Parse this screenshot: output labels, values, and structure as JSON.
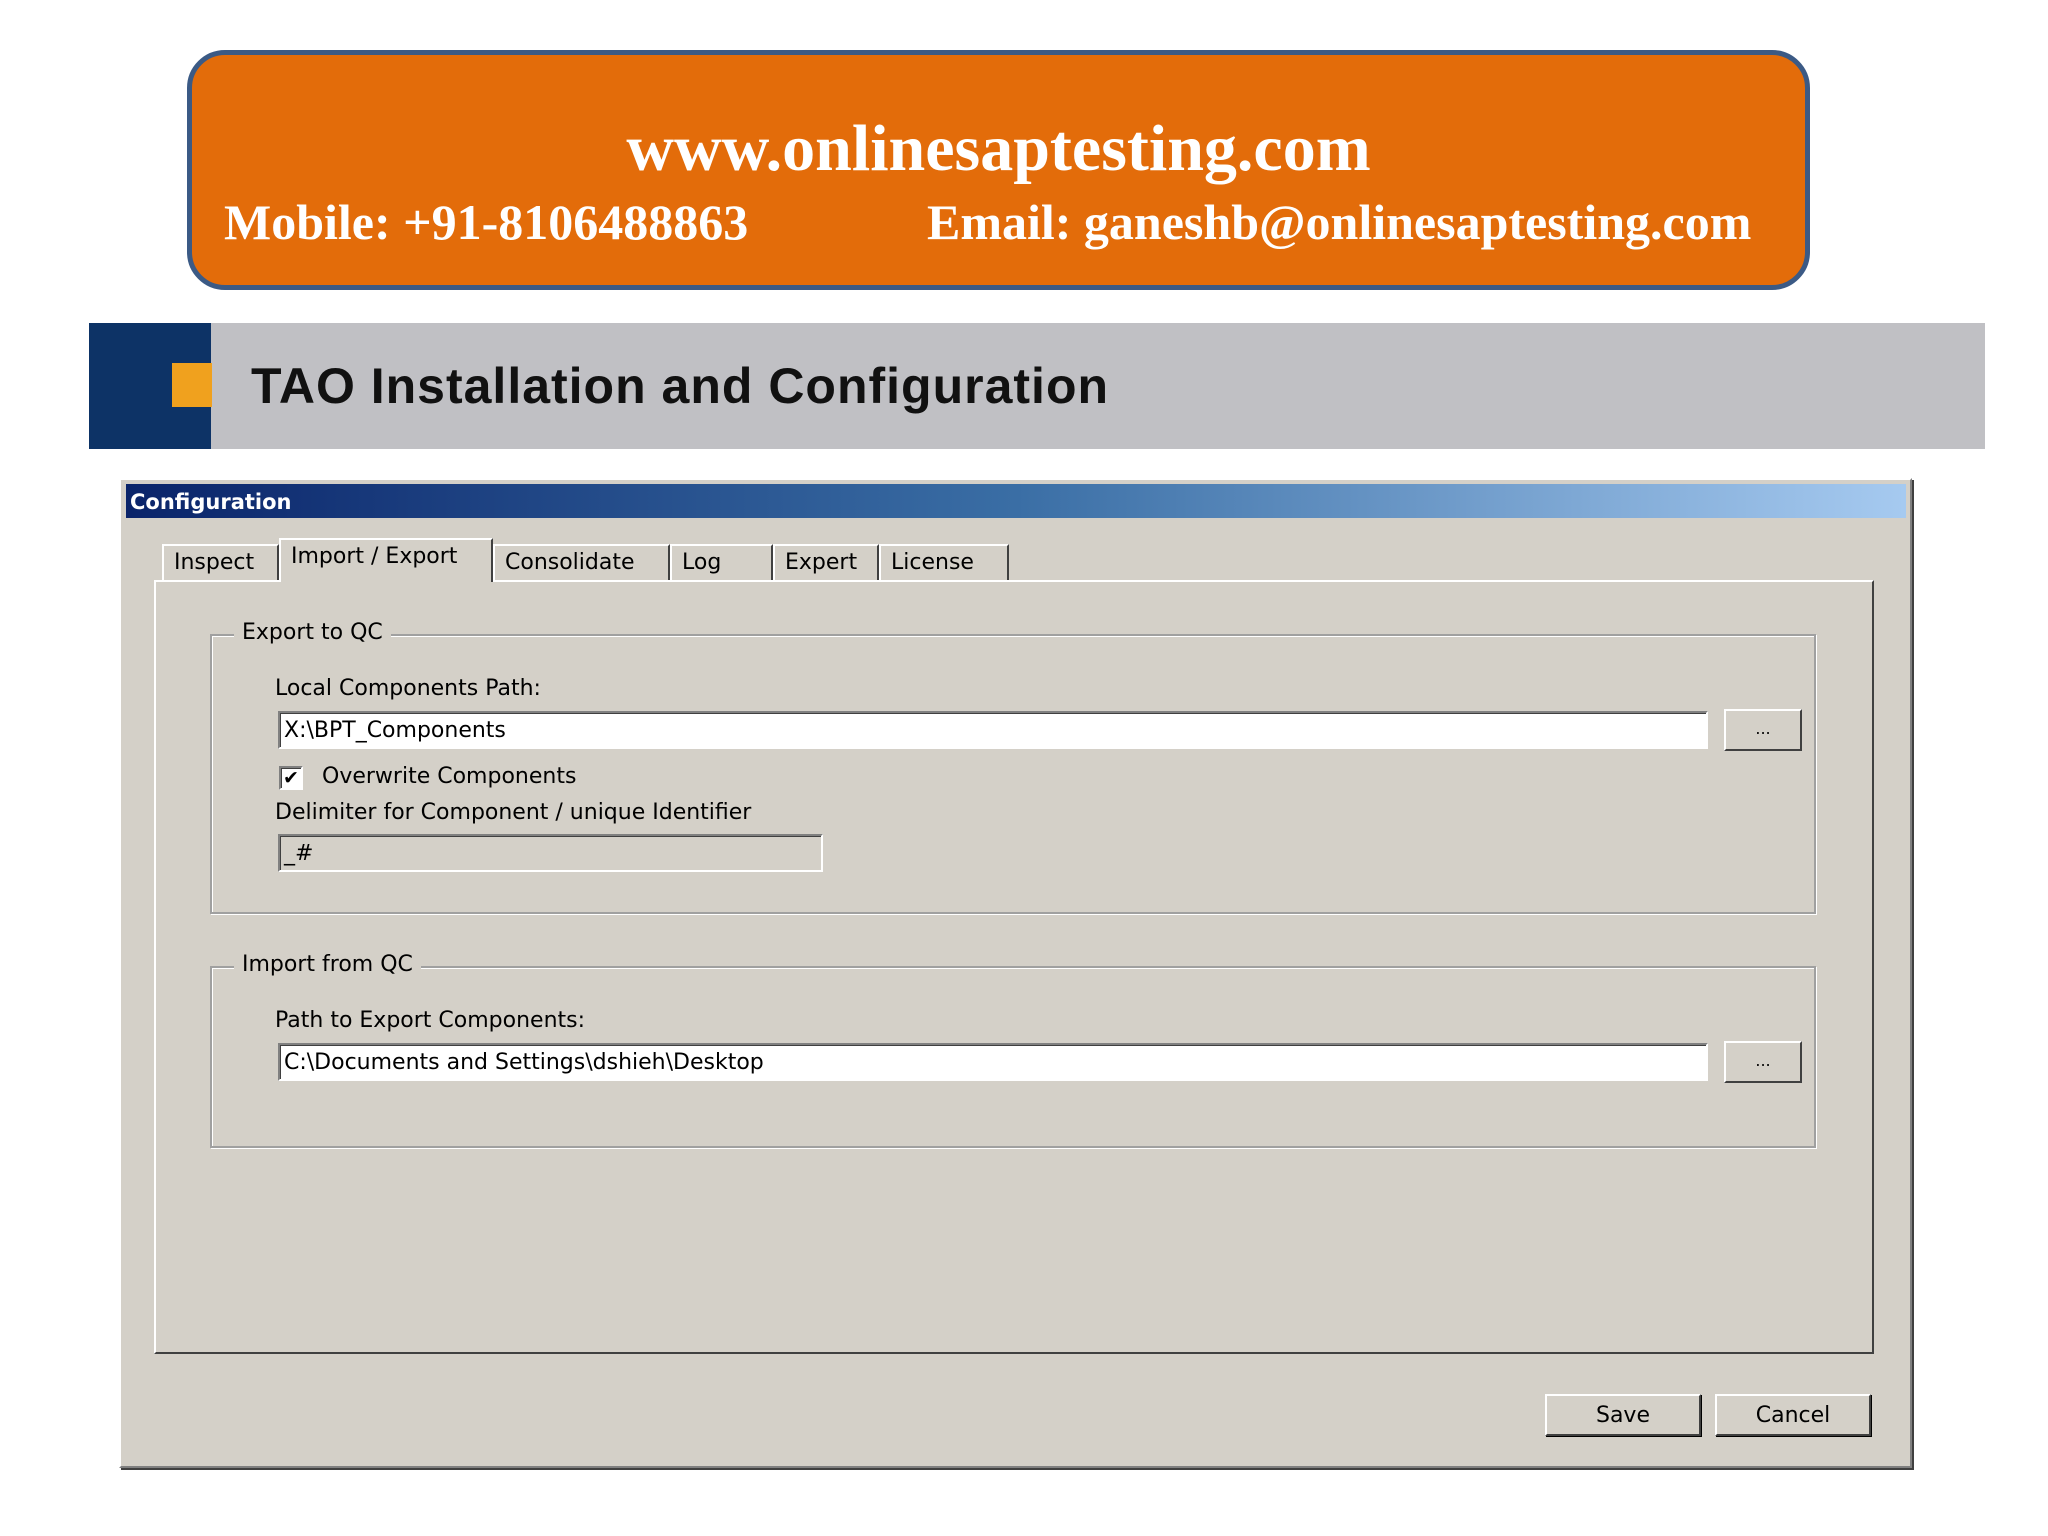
{
  "banner": {
    "url": "www.onlinesaptesting.com",
    "mobile": "Mobile: +91-8106488863",
    "email": "Email: ganeshb@onlinesaptesting.com"
  },
  "slide": {
    "title": "TAO Installation and Configuration"
  },
  "dialog": {
    "title": "Configuration",
    "tabs": [
      {
        "label": "Inspect"
      },
      {
        "label": "Import / Export",
        "active": true
      },
      {
        "label": "Consolidate"
      },
      {
        "label": "Log"
      },
      {
        "label": "Expert"
      },
      {
        "label": "License"
      }
    ],
    "export_group": {
      "title": "Export to QC",
      "path_label": "Local Components Path:",
      "path_value": "X:\\BPT_Components",
      "browse_label": "...",
      "overwrite_label": "Overwrite Components",
      "overwrite_checked": true,
      "check_glyph": "✔",
      "delimiter_label": "Delimiter for Component / unique Identifier",
      "delimiter_value": "_#"
    },
    "import_group": {
      "title": "Import from QC",
      "path_label": "Path to Export Components:",
      "path_value": "C:\\Documents and Settings\\dshieh\\Desktop",
      "browse_label": "..."
    },
    "buttons": {
      "save": "Save",
      "cancel": "Cancel"
    }
  },
  "colors": {
    "banner_bg": "#e36c0a",
    "banner_border": "#3b5a85",
    "title_bar": "#c0c0c4",
    "navy": "#0d3366",
    "accent_square": "#f0a11e",
    "dialog_face": "#d4d0c8"
  }
}
